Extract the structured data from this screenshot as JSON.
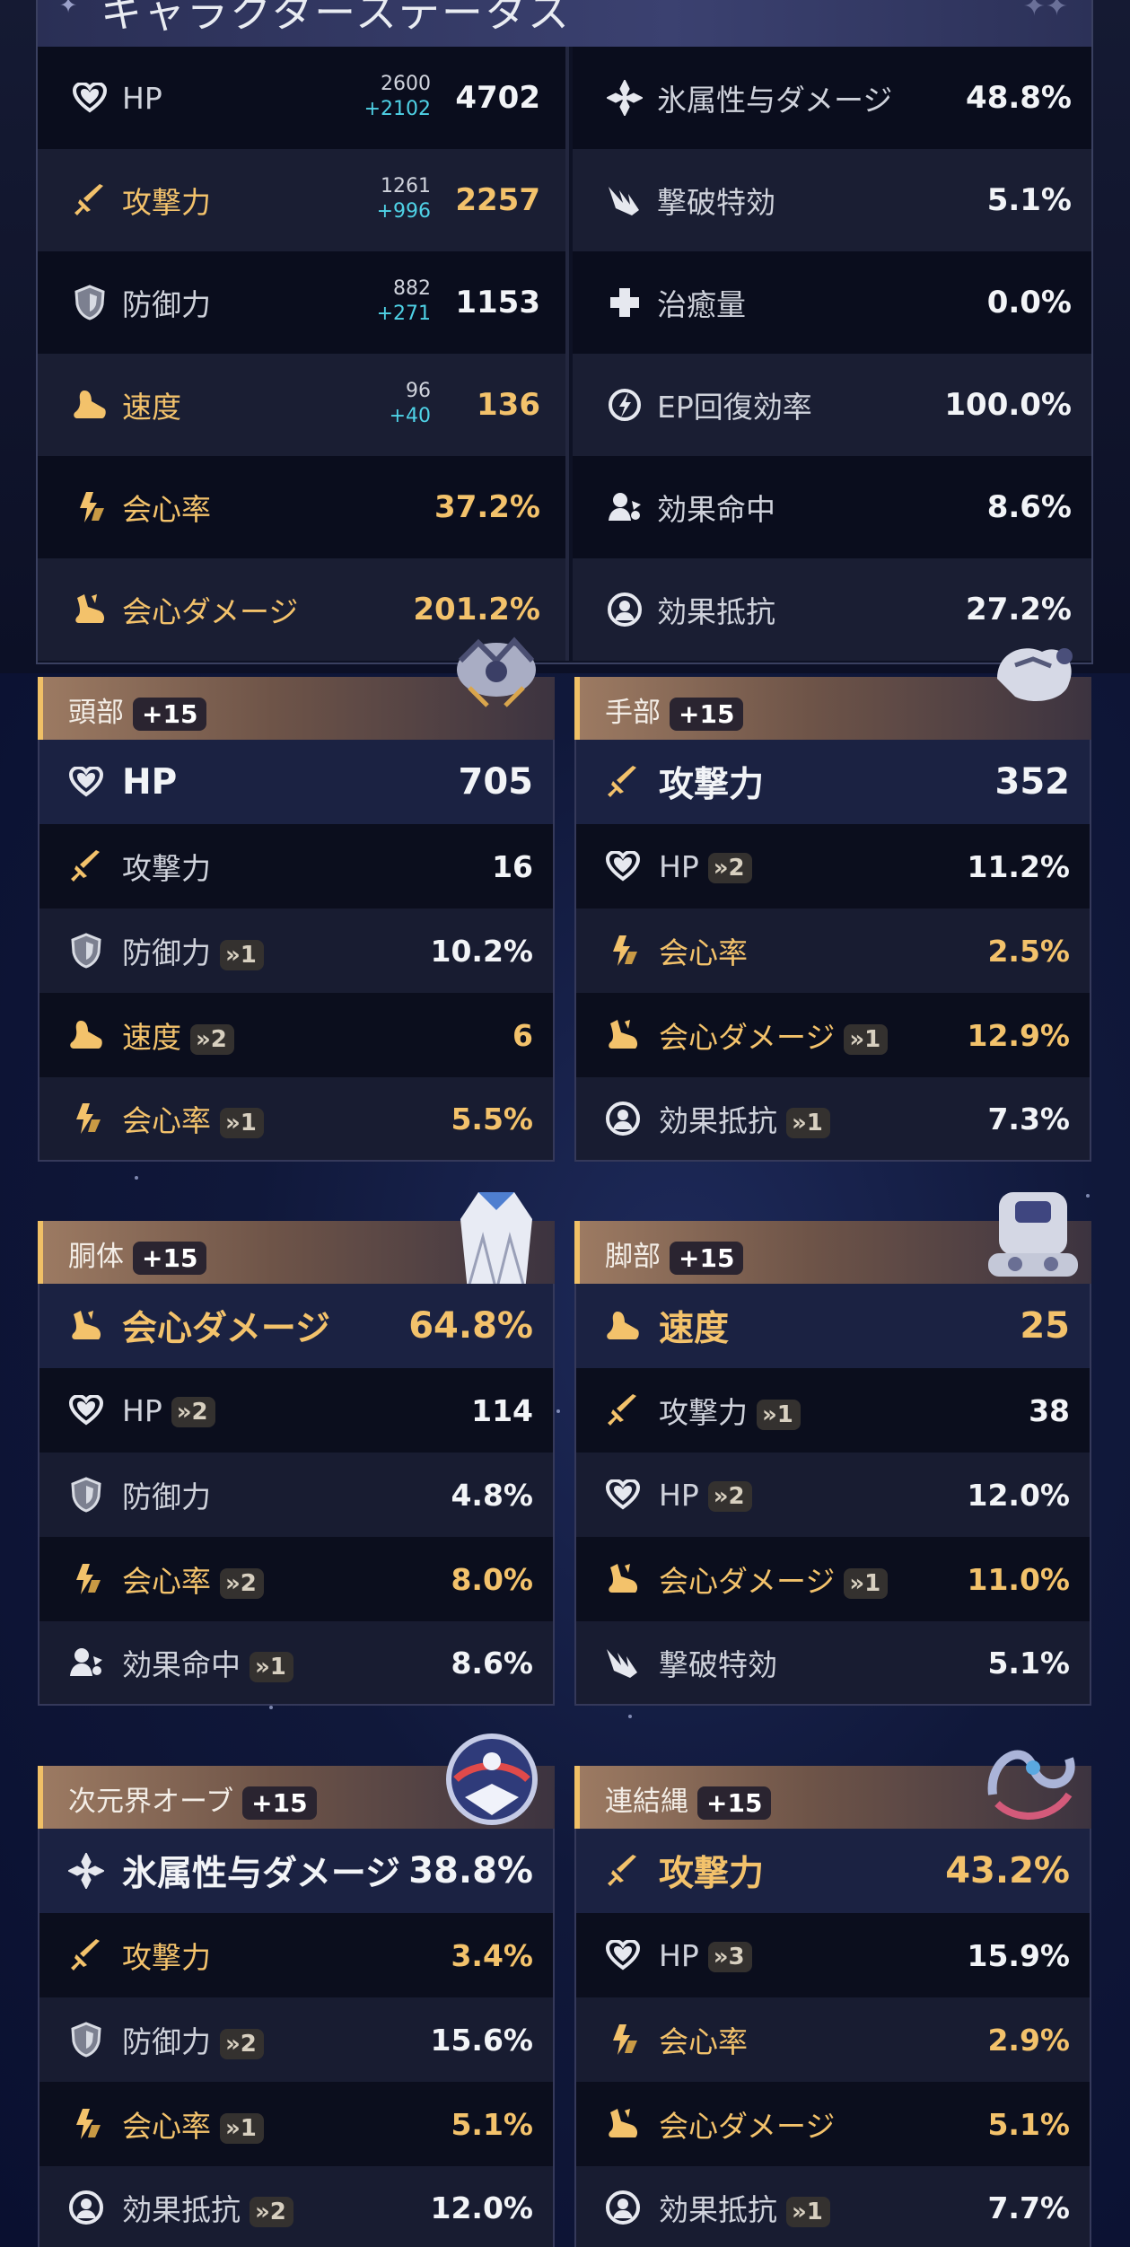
{
  "status_panel": {
    "title": "キャラクターステータス",
    "left": [
      {
        "icon": "hp-heart-icon",
        "label": "HP",
        "base": "2600",
        "bonus": "+2102",
        "value": "4702",
        "style": "white"
      },
      {
        "icon": "atk-sword-icon",
        "label": "攻撃力",
        "base": "1261",
        "bonus": "+996",
        "value": "2257",
        "style": "gold"
      },
      {
        "icon": "def-shield-icon",
        "label": "防御力",
        "base": "882",
        "bonus": "+271",
        "value": "1153",
        "style": "white"
      },
      {
        "icon": "spd-boot-icon",
        "label": "速度",
        "base": "96",
        "bonus": "+40",
        "value": "136",
        "style": "gold"
      },
      {
        "icon": "crit-rate-icon",
        "label": "会心率",
        "base": "",
        "bonus": "",
        "value": "37.2%",
        "style": "gold"
      },
      {
        "icon": "crit-dmg-icon",
        "label": "会心ダメージ",
        "base": "",
        "bonus": "",
        "value": "201.2%",
        "style": "gold"
      }
    ],
    "right": [
      {
        "icon": "ice-dmg-icon",
        "label": "氷属性与ダメージ",
        "value": "48.8%"
      },
      {
        "icon": "break-effect-icon",
        "label": "撃破特効",
        "value": "5.1%"
      },
      {
        "icon": "healing-cross-icon",
        "label": "治癒量",
        "value": "0.0%"
      },
      {
        "icon": "energy-regen-icon",
        "label": "EP回復効率",
        "value": "100.0%"
      },
      {
        "icon": "effect-hit-icon",
        "label": "効果命中",
        "value": "8.6%"
      },
      {
        "icon": "effect-res-icon",
        "label": "効果抵抗",
        "value": "27.2%"
      }
    ]
  },
  "relics": [
    {
      "slot": "頭部",
      "level": "+15",
      "main": {
        "icon": "hp-heart-icon",
        "label": "HP",
        "value": "705",
        "style": "white"
      },
      "subs": [
        {
          "icon": "atk-sword-icon",
          "label": "攻撃力",
          "rolls": "",
          "value": "16",
          "style": "white"
        },
        {
          "icon": "def-shield-icon",
          "label": "防御力",
          "rolls": "»1",
          "value": "10.2%",
          "style": "white"
        },
        {
          "icon": "spd-boot-icon",
          "label": "速度",
          "rolls": "»2",
          "value": "6",
          "style": "gold"
        },
        {
          "icon": "crit-rate-icon",
          "label": "会心率",
          "rolls": "»1",
          "value": "5.5%",
          "style": "gold"
        }
      ]
    },
    {
      "slot": "手部",
      "level": "+15",
      "main": {
        "icon": "atk-sword-icon",
        "label": "攻撃力",
        "value": "352",
        "style": "white"
      },
      "subs": [
        {
          "icon": "hp-heart-icon",
          "label": "HP",
          "rolls": "»2",
          "value": "11.2%",
          "style": "white"
        },
        {
          "icon": "crit-rate-icon",
          "label": "会心率",
          "rolls": "",
          "value": "2.5%",
          "style": "gold"
        },
        {
          "icon": "crit-dmg-icon",
          "label": "会心ダメージ",
          "rolls": "»1",
          "value": "12.9%",
          "style": "gold"
        },
        {
          "icon": "effect-res-icon",
          "label": "効果抵抗",
          "rolls": "»1",
          "value": "7.3%",
          "style": "white"
        }
      ]
    },
    {
      "slot": "胴体",
      "level": "+15",
      "main": {
        "icon": "crit-dmg-icon",
        "label": "会心ダメージ",
        "value": "64.8%",
        "style": "gold"
      },
      "subs": [
        {
          "icon": "hp-heart-icon",
          "label": "HP",
          "rolls": "»2",
          "value": "114",
          "style": "white"
        },
        {
          "icon": "def-shield-icon",
          "label": "防御力",
          "rolls": "",
          "value": "4.8%",
          "style": "white"
        },
        {
          "icon": "crit-rate-icon",
          "label": "会心率",
          "rolls": "»2",
          "value": "8.0%",
          "style": "gold"
        },
        {
          "icon": "effect-hit-icon",
          "label": "効果命中",
          "rolls": "»1",
          "value": "8.6%",
          "style": "white"
        }
      ]
    },
    {
      "slot": "脚部",
      "level": "+15",
      "main": {
        "icon": "spd-boot-icon",
        "label": "速度",
        "value": "25",
        "style": "gold"
      },
      "subs": [
        {
          "icon": "atk-sword-icon",
          "label": "攻撃力",
          "rolls": "»1",
          "value": "38",
          "style": "white"
        },
        {
          "icon": "hp-heart-icon",
          "label": "HP",
          "rolls": "»2",
          "value": "12.0%",
          "style": "white"
        },
        {
          "icon": "crit-dmg-icon",
          "label": "会心ダメージ",
          "rolls": "»1",
          "value": "11.0%",
          "style": "gold"
        },
        {
          "icon": "break-effect-icon",
          "label": "撃破特効",
          "rolls": "",
          "value": "5.1%",
          "style": "white"
        }
      ]
    },
    {
      "slot": "次元界オーブ",
      "level": "+15",
      "main": {
        "icon": "ice-dmg-icon",
        "label": "氷属性与ダメージ",
        "value": "38.8%",
        "style": "white"
      },
      "subs": [
        {
          "icon": "atk-sword-icon",
          "label": "攻撃力",
          "rolls": "",
          "value": "3.4%",
          "style": "gold"
        },
        {
          "icon": "def-shield-icon",
          "label": "防御力",
          "rolls": "»2",
          "value": "15.6%",
          "style": "white"
        },
        {
          "icon": "crit-rate-icon",
          "label": "会心率",
          "rolls": "»1",
          "value": "5.1%",
          "style": "gold"
        },
        {
          "icon": "effect-res-icon",
          "label": "効果抵抗",
          "rolls": "»2",
          "value": "12.0%",
          "style": "white"
        }
      ]
    },
    {
      "slot": "連結縄",
      "level": "+15",
      "main": {
        "icon": "atk-sword-icon",
        "label": "攻撃力",
        "value": "43.2%",
        "style": "gold"
      },
      "subs": [
        {
          "icon": "hp-heart-icon",
          "label": "HP",
          "rolls": "»3",
          "value": "15.9%",
          "style": "white"
        },
        {
          "icon": "crit-rate-icon",
          "label": "会心率",
          "rolls": "",
          "value": "2.9%",
          "style": "gold"
        },
        {
          "icon": "crit-dmg-icon",
          "label": "会心ダメージ",
          "rolls": "",
          "value": "5.1%",
          "style": "gold"
        },
        {
          "icon": "effect-res-icon",
          "label": "効果抵抗",
          "rolls": "»1",
          "value": "7.7%",
          "style": "white"
        }
      ]
    }
  ],
  "colors": {
    "gold": "#f3c26b",
    "white": "#f2f4f7",
    "roll_bonus": "#4fd2e6",
    "slot_accent": "#f0c066"
  }
}
